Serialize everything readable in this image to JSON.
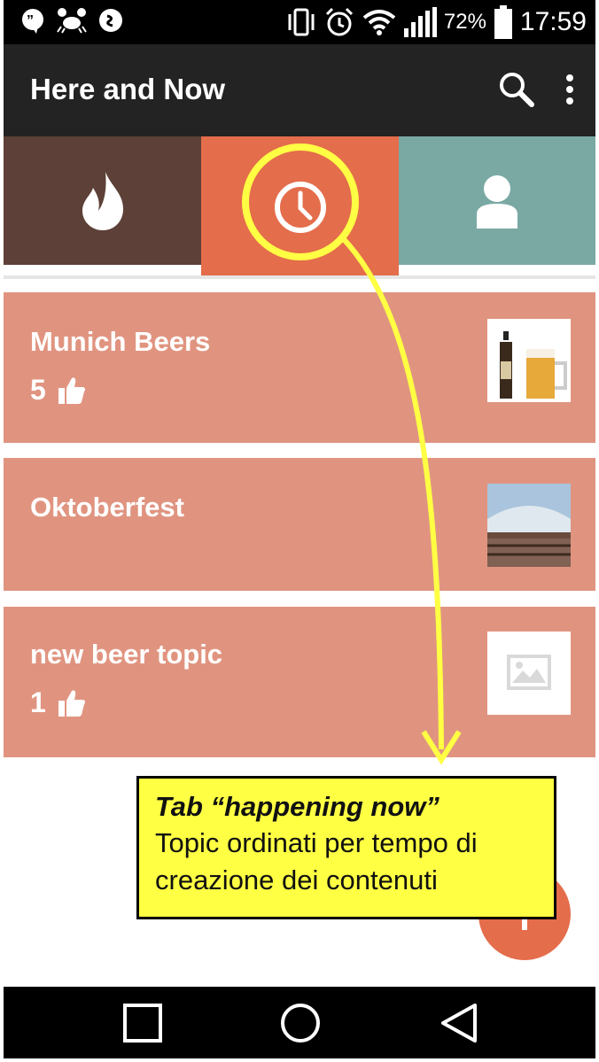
{
  "status_bar": {
    "icons": [
      "hangouts-icon",
      "crab-icon",
      "shazam-icon",
      "vibrate-icon",
      "alarm-icon",
      "wifi-icon",
      "signal-icon",
      "battery-icon"
    ],
    "battery": "72%",
    "time": "17:59"
  },
  "app_bar": {
    "title": "Here and Now",
    "actions": [
      "search-icon",
      "overflow-menu-icon"
    ]
  },
  "tabs": [
    {
      "icon": "flame-icon",
      "color": "#5d4037",
      "selected": false
    },
    {
      "icon": "clock-icon",
      "color": "#e46d4b",
      "selected": true
    },
    {
      "icon": "person-icon",
      "color": "#7aa9a4",
      "selected": false
    }
  ],
  "topics": [
    {
      "title": "Munich Beers",
      "likes": "5",
      "thumbnail": "beer-bottle-and-mug-image"
    },
    {
      "title": "Oktoberfest",
      "likes": "",
      "thumbnail": "oktoberfest-tent-image"
    },
    {
      "title": "new beer topic",
      "likes": "1",
      "thumbnail": "placeholder-image-icon"
    }
  ],
  "annotation": {
    "title": "Tab “happening now”",
    "line1": "Topic ordinati per tempo di",
    "line2": "creazione dei contenuti",
    "color": "#ffff44"
  },
  "fab": {
    "icon": "add-icon",
    "color": "#e46d4b"
  },
  "nav_bar": {
    "buttons": [
      "recents-square-icon",
      "home-circle-icon",
      "back-triangle-icon"
    ]
  },
  "colors": {
    "card": "#e09480",
    "app_bar": "#232323",
    "highlight": "#ffff44"
  }
}
